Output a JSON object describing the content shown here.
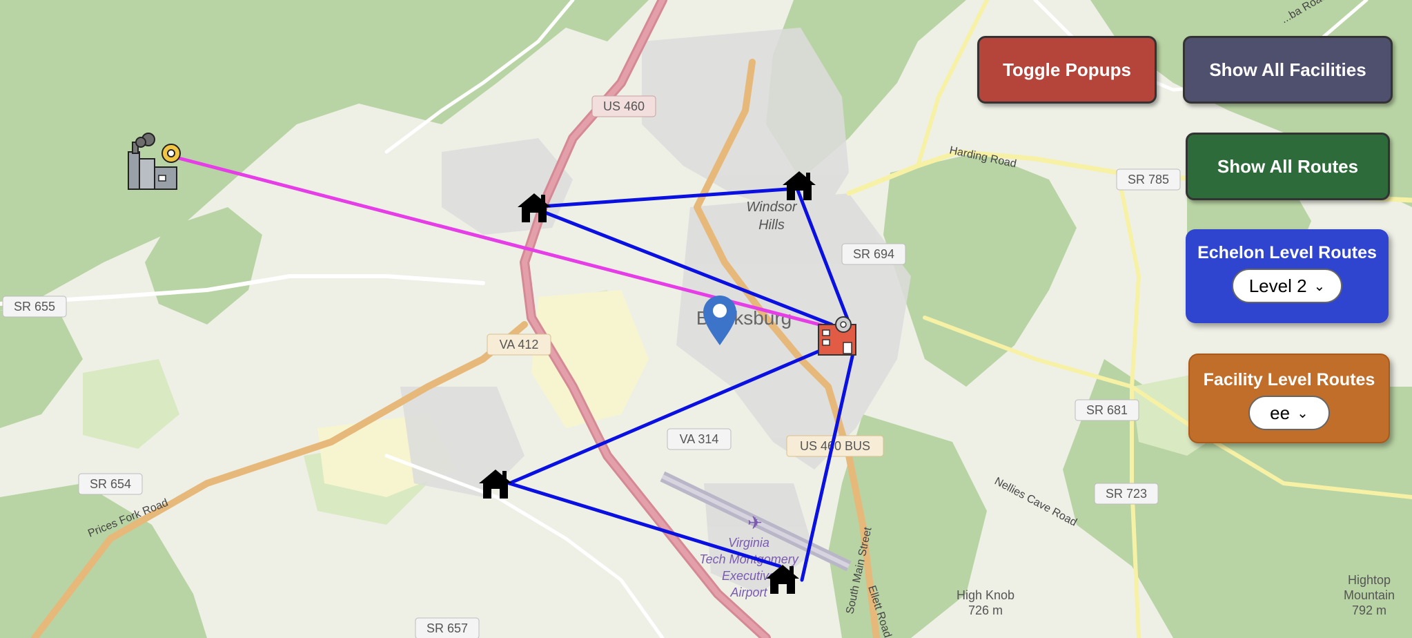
{
  "controls": {
    "toggle_popups": "Toggle Popups",
    "show_all_facilities": "Show All Facilities",
    "show_all_routes": "Show All Routes",
    "echelon": {
      "label": "Echelon Level Routes",
      "selected": "Level 2"
    },
    "facility": {
      "label": "Facility Level Routes",
      "selected": "ee"
    }
  },
  "colors": {
    "toggle_popups": "#b5443a",
    "show_all_facilities": "#4f4f6e",
    "show_all_routes": "#2e6b3a",
    "echelon_panel": "#2f45d0",
    "facility_panel": "#c06e2a",
    "route_blue": "#0a10e0",
    "route_magenta": "#e63ee6",
    "marker": "#3b74c9"
  },
  "map_labels": {
    "us460": "US 460",
    "windsor": "Windsor",
    "hills": "Hills",
    "harding": "Harding Road",
    "sr785": "SR 785",
    "sr694": "SR 694",
    "sr655": "SR 655",
    "blacksburg": "Blacksburg",
    "va412": "VA 412",
    "va314": "VA 314",
    "us460bus": "US 460 BUS",
    "sr681": "SR 681",
    "nellies": "Nellies Cave Road",
    "sr723": "SR 723",
    "sr654": "SR 654",
    "prices": "Prices Fork Road",
    "virginia": "Virginia",
    "tech": "Tech Montgomery",
    "executive": "Executive",
    "airport": "Airport",
    "south_main": "South Main Street",
    "ellett": "Ellett Road",
    "high_knob": "High Knob",
    "high_knob_elev": "726 m",
    "hightop": "Hightop",
    "mountain": "Mountain",
    "hightop_elev": "792 m",
    "sr657": "SR 657",
    "topright_road": "...ba Road"
  },
  "icons": {
    "source_factory": "factory-icon",
    "hub_factory": "factory-hub-icon",
    "house": "house-icon",
    "marker": "map-marker-icon"
  }
}
